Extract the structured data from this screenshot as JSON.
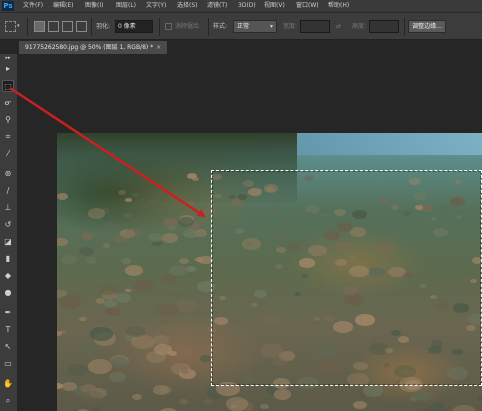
{
  "app": {
    "logo": "Ps"
  },
  "menu": [
    "文件(F)",
    "编辑(E)",
    "图像(I)",
    "图层(L)",
    "文字(Y)",
    "选择(S)",
    "滤镜(T)",
    "3D(D)",
    "视图(V)",
    "窗口(W)",
    "帮助(H)"
  ],
  "options": {
    "feather_label": "羽化:",
    "feather_value": "0 像素",
    "antialias_label": "消除锯齿",
    "style_label": "样式:",
    "style_value": "正常",
    "width_label": "宽度:",
    "height_label": "高度:",
    "refine_edge_button": "调整边缘..."
  },
  "document_tab": {
    "title": "91775262580.jpg @ 50% (图层 1, RGB/8) *",
    "close": "×"
  },
  "tools": [
    {
      "icon": "move-tool-icon",
      "glyph": "▸"
    },
    {
      "icon": "rectangular-marquee-icon",
      "glyph": "⬚",
      "active": true
    },
    {
      "icon": "lasso-icon",
      "glyph": "ᓂ"
    },
    {
      "icon": "quick-selection-icon",
      "glyph": "⚲"
    },
    {
      "icon": "crop-icon",
      "glyph": "⌗"
    },
    {
      "icon": "eyedropper-icon",
      "glyph": "⁄"
    },
    {
      "icon": "healing-brush-icon",
      "glyph": "⊛"
    },
    {
      "icon": "brush-icon",
      "glyph": "∕"
    },
    {
      "icon": "clone-stamp-icon",
      "glyph": "⊥"
    },
    {
      "icon": "history-brush-icon",
      "glyph": "↺"
    },
    {
      "icon": "eraser-icon",
      "glyph": "◪"
    },
    {
      "icon": "gradient-icon",
      "glyph": "▮"
    },
    {
      "icon": "blur-icon",
      "glyph": "◆"
    },
    {
      "icon": "dodge-icon",
      "glyph": "●"
    },
    {
      "icon": "pen-icon",
      "glyph": "✒"
    },
    {
      "icon": "type-icon",
      "glyph": "T"
    },
    {
      "icon": "path-selection-icon",
      "glyph": "↖"
    },
    {
      "icon": "shape-icon",
      "glyph": "▭"
    },
    {
      "icon": "hand-icon",
      "glyph": "✋"
    },
    {
      "icon": "zoom-icon",
      "glyph": "⌕"
    }
  ],
  "colors": {
    "annotation_arrow": "#cc1f1f",
    "selection": "#ffffff"
  }
}
